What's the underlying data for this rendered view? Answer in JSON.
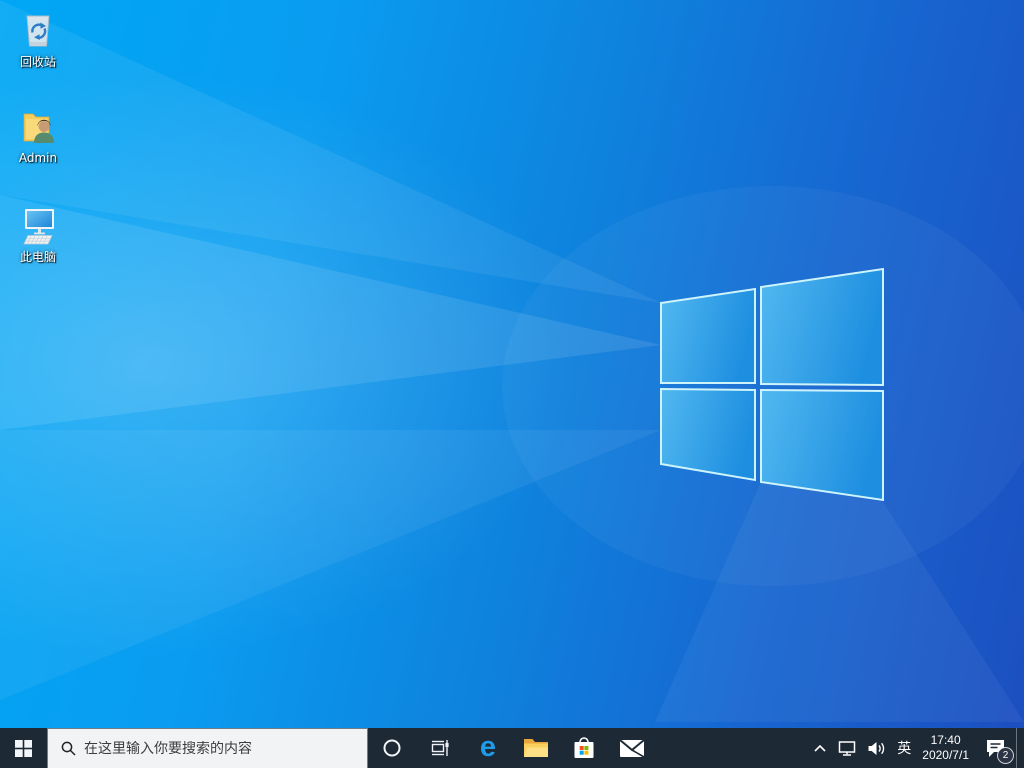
{
  "desktop": {
    "icons": [
      {
        "id": "recycle-bin",
        "label": "回收站"
      },
      {
        "id": "user-folder",
        "label": "Admin"
      },
      {
        "id": "this-pc",
        "label": "此电脑"
      }
    ]
  },
  "taskbar": {
    "search_placeholder": "在这里输入你要搜索的内容",
    "buttons": [
      "cortana",
      "task-view",
      "edge",
      "file-explorer",
      "store",
      "mail"
    ],
    "tray": {
      "ime_label": "英",
      "time": "17:40",
      "date": "2020/7/1",
      "notification_count": "2"
    }
  },
  "colors": {
    "taskbar_bg": "#1d2935",
    "wallpaper_left": "#00a7f5",
    "wallpaper_right": "#1c4fc0",
    "logo_pane_light": "#52b8f0",
    "logo_pane_dark": "#1e8fe0",
    "logo_edge": "#cdf4fb",
    "edge_blue": "#1e9be9",
    "folder_yellow": "#f6cd5a",
    "store_red": "#f25022",
    "store_green": "#7fba00",
    "store_blue": "#00a4ef",
    "store_yellow": "#ffb900"
  }
}
